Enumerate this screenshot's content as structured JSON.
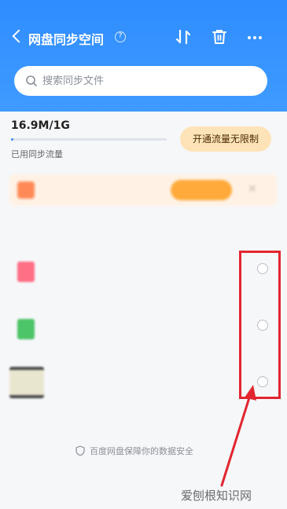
{
  "header": {
    "title": "网盘同步空间",
    "help_icon": "question-circle-icon",
    "sort_icon": "sort-icon",
    "trash_icon": "trash-icon",
    "more_icon": "more-horizontal-icon"
  },
  "search": {
    "placeholder": "搜索同步文件",
    "value": ""
  },
  "quota": {
    "used_text": "16.9M/1G",
    "used_fraction": 0.017,
    "label": "已用同步流量",
    "upgrade_label": "开通流量无限制"
  },
  "files": [
    {
      "icon": "pdf-file-icon"
    },
    {
      "icon": "excel-file-icon"
    },
    {
      "icon": "video-file-icon"
    }
  ],
  "footer": {
    "text": "百度网盘保障你的数据安全",
    "icon": "shield-icon"
  },
  "watermark": {
    "text": "爱刨根知识网"
  },
  "colors": {
    "header_blue": "#3a95ff",
    "highlight_red": "#e2252f",
    "upgrade_bg": "#ffe3b8"
  }
}
